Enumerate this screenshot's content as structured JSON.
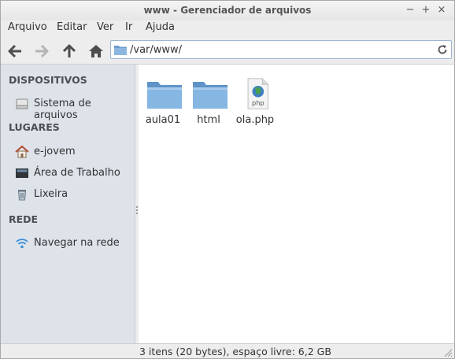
{
  "window": {
    "title": "www - Gerenciador de arquivos",
    "controls": [
      "−",
      "+",
      "×"
    ]
  },
  "menubar": {
    "items": [
      "Arquivo",
      "Editar",
      "Ver",
      "Ir",
      "Ajuda"
    ]
  },
  "toolbar": {
    "back": "arrow-left-icon",
    "forward": "arrow-right-icon",
    "up": "arrow-up-icon",
    "home": "home-icon",
    "path": "/var/www/",
    "reload": "reload-icon"
  },
  "sidebar": {
    "sections": [
      {
        "title": "DISPOSITIVOS",
        "items": [
          {
            "label": "Sistema de arquivos",
            "icon": "drive-icon"
          }
        ]
      },
      {
        "title": "LUGARES",
        "items": [
          {
            "label": "e-jovem",
            "icon": "home-icon"
          },
          {
            "label": "Área de Trabalho",
            "icon": "desktop-icon"
          },
          {
            "label": "Lixeira",
            "icon": "trash-icon"
          }
        ]
      },
      {
        "title": "REDE",
        "items": [
          {
            "label": "Navegar na rede",
            "icon": "network-icon"
          }
        ]
      }
    ]
  },
  "files": [
    {
      "name": "aula01",
      "icon": "folder-icon"
    },
    {
      "name": "html",
      "icon": "folder-icon"
    },
    {
      "name": "ola.php",
      "icon": "php-file-icon",
      "badge": "php"
    }
  ],
  "status": {
    "text": "3 itens (20 bytes), espaço livre: 6,2 GB"
  },
  "colors": {
    "sidebar_bg": "#dee3ea",
    "folder": "#7aaedc",
    "content_bg": "#ffffff"
  }
}
